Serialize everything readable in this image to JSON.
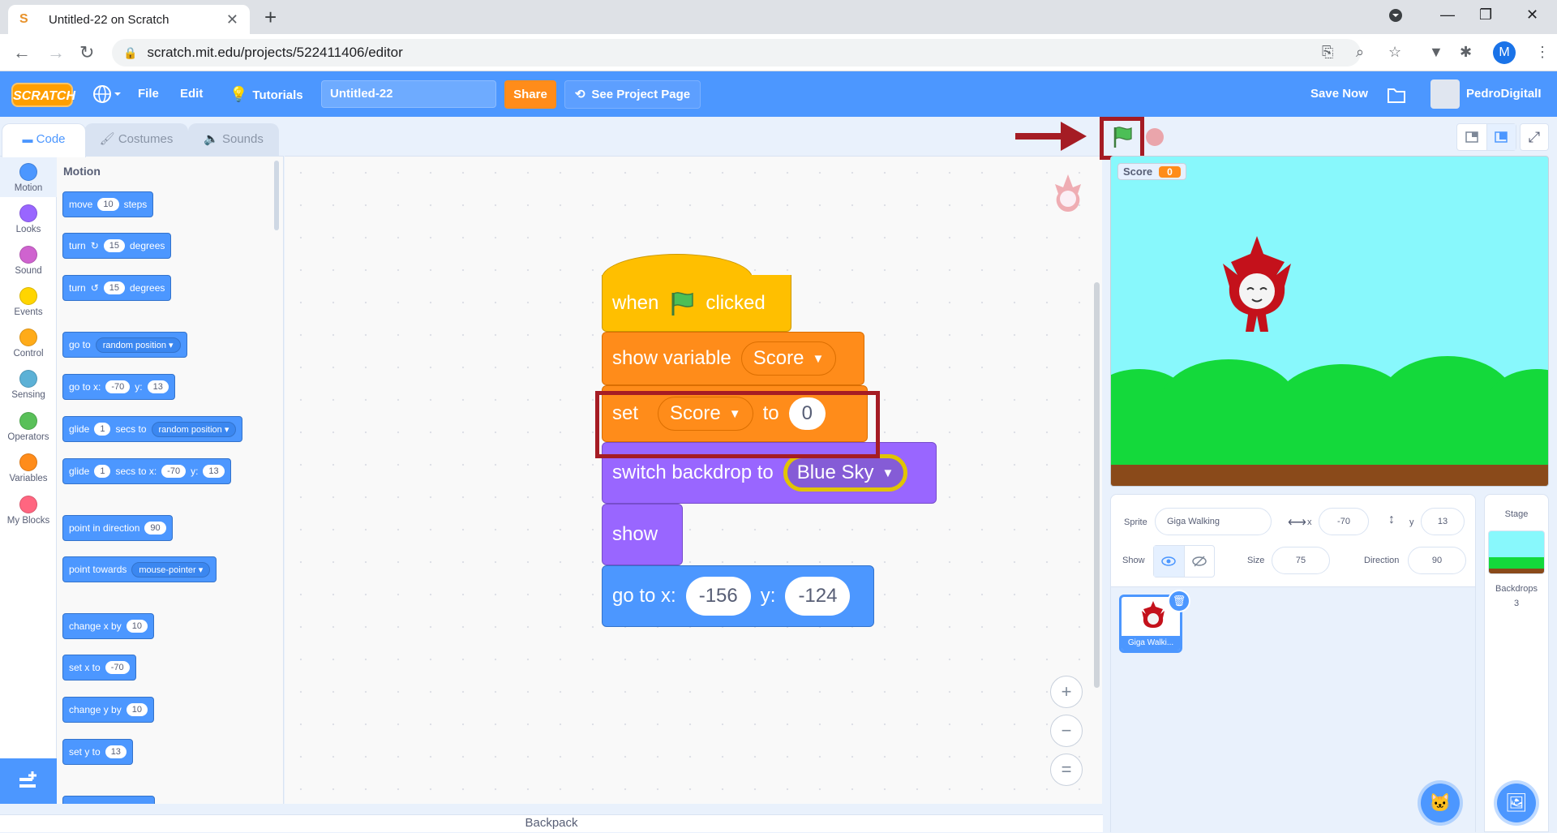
{
  "browser": {
    "tab_title": "Untitled-22 on Scratch",
    "url": "scratch.mit.edu/projects/522411406/editor",
    "profile_initial": "M"
  },
  "menu": {
    "logo": "SCRATCH",
    "file": "File",
    "edit": "Edit",
    "tutorials": "Tutorials",
    "project_title": "Untitled-22",
    "share": "Share",
    "see_project_page": "See Project Page",
    "save_now": "Save Now",
    "username": "PedroDigitalI"
  },
  "tabs": {
    "code": "Code",
    "costumes": "Costumes",
    "sounds": "Sounds"
  },
  "categories": [
    {
      "label": "Motion",
      "color": "#4c97ff"
    },
    {
      "label": "Looks",
      "color": "#9966ff"
    },
    {
      "label": "Sound",
      "color": "#cf63cf"
    },
    {
      "label": "Events",
      "color": "#ffd500"
    },
    {
      "label": "Control",
      "color": "#ffab19"
    },
    {
      "label": "Sensing",
      "color": "#5cb1d6"
    },
    {
      "label": "Operators",
      "color": "#59c059"
    },
    {
      "label": "Variables",
      "color": "#ff8c1a"
    },
    {
      "label": "My Blocks",
      "color": "#ff6680"
    }
  ],
  "palette": {
    "heading": "Motion",
    "move": {
      "a": "move",
      "v": "10",
      "b": "steps"
    },
    "turn_cw": {
      "a": "turn",
      "v": "15",
      "b": "degrees"
    },
    "turn_ccw": {
      "a": "turn",
      "v": "15",
      "b": "degrees"
    },
    "goto": {
      "a": "go to",
      "dd": "random position"
    },
    "gotoxy": {
      "a": "go to x:",
      "x": "-70",
      "b": "y:",
      "y": "13"
    },
    "glide_to": {
      "a": "glide",
      "v": "1",
      "b": "secs to",
      "dd": "random position"
    },
    "glide_xy": {
      "a": "glide",
      "v": "1",
      "b": "secs to x:",
      "x": "-70",
      "c": "y:",
      "y": "13"
    },
    "point_dir": {
      "a": "point in direction",
      "v": "90"
    },
    "point_towards": {
      "a": "point towards",
      "dd": "mouse-pointer"
    },
    "change_x": {
      "a": "change x by",
      "v": "10"
    },
    "set_x": {
      "a": "set x to",
      "v": "-70"
    },
    "change_y": {
      "a": "change y by",
      "v": "10"
    },
    "set_y": {
      "a": "set y to",
      "v": "13"
    }
  },
  "script": {
    "hat": {
      "when": "when",
      "clicked": "clicked"
    },
    "show_variable": {
      "label": "show variable",
      "dd": "Score"
    },
    "set_var": {
      "label": "set",
      "dd": "Score",
      "to": "to",
      "value": "0"
    },
    "switch_backdrop": {
      "label": "switch backdrop to",
      "dd": "Blue Sky"
    },
    "show": {
      "label": "show"
    },
    "goto_xy": {
      "label": "go to x:",
      "x": "-156",
      "ylabel": "y:",
      "y": "-124"
    }
  },
  "workspace": {
    "zoom_in": "+",
    "zoom_out": "−",
    "zoom_reset": "=",
    "backpack": "Backpack"
  },
  "stage": {
    "monitor_label": "Score",
    "monitor_value": "0"
  },
  "sprite_info": {
    "sprite_label": "Sprite",
    "sprite_name": "Giga Walking",
    "x_label": "x",
    "x": "-70",
    "y_label": "y",
    "y": "13",
    "show_label": "Show",
    "size_label": "Size",
    "size": "75",
    "direction_label": "Direction",
    "direction": "90"
  },
  "sprites": [
    {
      "name": "Giga Walki..."
    }
  ],
  "stage_panel": {
    "title": "Stage",
    "backdrops_label": "Backdrops",
    "backdrops_count": "3"
  },
  "colors": {
    "motion": "#4c97ff",
    "events": "#ffbf00",
    "variables": "#ff8c1a",
    "looks": "#9966ff",
    "highlight": "#a51c24"
  }
}
